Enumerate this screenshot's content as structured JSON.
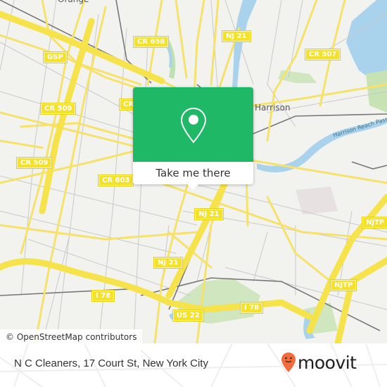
{
  "map": {
    "place_labels": {
      "orange": "Orange",
      "harrison": "Harrison"
    },
    "water_labels": {
      "harrison_reach": "Harrison Reach Passaic"
    },
    "road_shields": [
      {
        "id": "cr658",
        "label": "CR 658"
      },
      {
        "id": "nj21_top",
        "label": "NJ 21"
      },
      {
        "id": "cr507",
        "label": "CR 507"
      },
      {
        "id": "gsp",
        "label": "GSP"
      },
      {
        "id": "cr509_a",
        "label": "CR 509"
      },
      {
        "id": "cr5xx_partial",
        "label": "CR"
      },
      {
        "id": "cr509_b",
        "label": "CR 509"
      },
      {
        "id": "cr603",
        "label": "CR 603"
      },
      {
        "id": "nj21_mid",
        "label": "NJ 21"
      },
      {
        "id": "njtp_a",
        "label": "NJTP"
      },
      {
        "id": "nj21_low",
        "label": "NJ 21"
      },
      {
        "id": "i78_a",
        "label": "I 78"
      },
      {
        "id": "us22",
        "label": "US 22"
      },
      {
        "id": "i78_b",
        "label": "I 78"
      },
      {
        "id": "njtp_b",
        "label": "NJTP"
      }
    ],
    "attribution": "© OpenStreetMap contributors"
  },
  "popup": {
    "action_label": "Take me there",
    "accent_color": "#1fb866",
    "icon": "location-pin-icon"
  },
  "footer": {
    "title": "N C Cleaners, 17 Court St, New York City",
    "brand": "moovit",
    "brand_color": "#f26b3a"
  }
}
